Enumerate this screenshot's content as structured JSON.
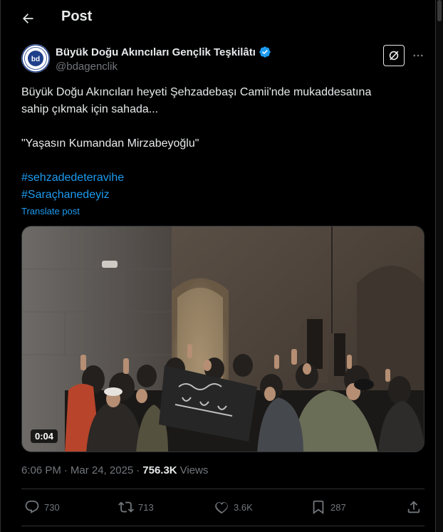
{
  "header": {
    "title": "Post"
  },
  "author": {
    "name": "Büyük Doğu Akıncıları Gençlik Teşkilâtı",
    "handle": "@bdagenclik",
    "avatar_text": "bd",
    "verified": true
  },
  "tweet": {
    "line1": "Büyük Doğu Akıncıları heyeti Şehzadebaşı Camii'nde mukaddesatına",
    "line2": "sahip çıkmak için sahada...",
    "quote": "\"Yaşasın Kumandan Mirzabeyoğlu\"",
    "hashtags": [
      "#sehzadedeteravihe",
      "#Saraçhanedeyiz"
    ],
    "translate_label": "Translate post"
  },
  "video": {
    "duration": "0:04"
  },
  "meta": {
    "time": "6:06 PM",
    "separator": "·",
    "date": "Mar 24, 2025",
    "views_count": "756.3K",
    "views_label": "Views"
  },
  "actions": {
    "replies": "730",
    "reposts": "713",
    "likes": "3.6K",
    "bookmarks": "287"
  },
  "colors": {
    "accent": "#1d9bf0",
    "text": "#e7e9ea",
    "muted": "#71767b",
    "border": "#2f3336",
    "verified": "#1d9bf0"
  }
}
